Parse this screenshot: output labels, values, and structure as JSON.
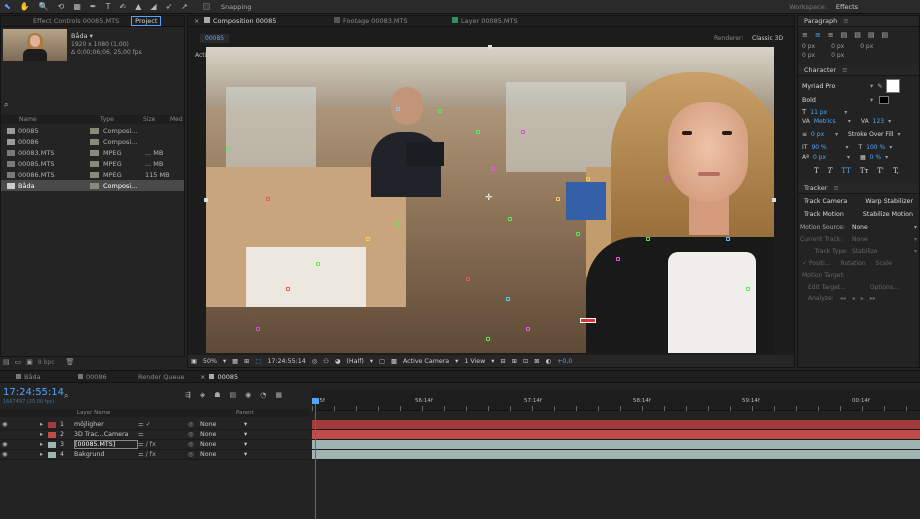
{
  "toolbar": {
    "tools": [
      "⬉",
      "✋",
      "🔍",
      "⟲",
      "▦",
      "✒",
      "T",
      "✍",
      "▲",
      "◢",
      "➶",
      "➚"
    ],
    "snapping": "Snapping",
    "workspace_label": "Workspace:",
    "workspace_value": "Effects"
  },
  "left_panel": {
    "tabs": [
      "Effect Controls 00085.MTS",
      "Project"
    ],
    "item_name": "Båda ▾",
    "item_info1": "1920 x 1080 (1,00)",
    "item_info2": "Δ 0;00;06;06, 25,00 fps",
    "cols": [
      "Name",
      "Type",
      "Size",
      "Med"
    ],
    "items": [
      {
        "name": "00085",
        "type": "Composi...",
        "size": ""
      },
      {
        "name": "00086",
        "type": "Composi...",
        "size": ""
      },
      {
        "name": "00083.MTS",
        "type": "MPEG",
        "size": "... MB"
      },
      {
        "name": "00085.MTS",
        "type": "MPEG",
        "size": "... MB"
      },
      {
        "name": "00086.MTS",
        "type": "MPEG",
        "size": "115 MB"
      },
      {
        "name": "Båda",
        "type": "Composi...",
        "size": ""
      }
    ],
    "bpc": "8 bpc"
  },
  "viewer": {
    "tabs": [
      "Composition 00085",
      "Footage 00083.MTS",
      "Layer 00085.MTS"
    ],
    "comp_btn": "00085",
    "renderer_label": "Renderer:",
    "renderer_value": "Classic 3D",
    "active_camera": "Active Camera",
    "footer": {
      "zoom": "50%",
      "timecode": "17:24:55:14",
      "quality": "(Half)",
      "camera": "Active Camera",
      "view": "1 View",
      "exposure": "+0,0"
    }
  },
  "right": {
    "paragraph": "Paragraph",
    "para_vals": [
      "0 px",
      "0 px",
      "0 px",
      "0 px",
      "0 px"
    ],
    "character": "Character",
    "font": "Myriad Pro",
    "style": "Bold",
    "size": "11 px",
    "tracking_label": "Metrics",
    "kerning": "123",
    "stroke_px": "0 px",
    "stroke_mode": "Stroke Over Fill",
    "vscale": "90 %",
    "hscale": "100 %",
    "baseline": "0 px",
    "tsume": "0 %",
    "styles": [
      "T",
      "T",
      "TT",
      "Tᴛ",
      "T'",
      "T,"
    ],
    "tracker": "Tracker",
    "track_camera": "Track Camera",
    "warp": "Warp Stabilizer",
    "track_motion": "Track Motion",
    "stab_motion": "Stabilize Motion",
    "motion_source_label": "Motion Source:",
    "motion_source": "None",
    "current_track_label": "Current Track:",
    "current_track": "None",
    "track_type_label": "Track Type:",
    "track_type": "Stabilize",
    "position": "Positi...",
    "rotation": "Rotation",
    "scale": "Scale",
    "motion_target": "Motion Target:",
    "edit_target": "Edit Target...",
    "options": "Options...",
    "analyze": "Analyze:"
  },
  "timeline": {
    "tabs": [
      "Båda",
      "00086",
      "Render Queue",
      "00085"
    ],
    "timecode": "17:24:55:14",
    "fps_info": "1667497 (25.00 fps)",
    "layer_header": "Layer Name",
    "parent_header": "Parent",
    "ruler": [
      "55f",
      "56:14f",
      "57:14f",
      "58:14f",
      "59:14f",
      "00:14f"
    ],
    "layers": [
      {
        "num": "1",
        "name": "möjligher",
        "parent": "None",
        "color": "#a23b3b"
      },
      {
        "num": "2",
        "name": "3D Trac...Camera",
        "parent": "None",
        "color": "#c04b4b"
      },
      {
        "num": "3",
        "name": "[00085.MTS]",
        "parent": "None",
        "color": "#9fb3b0"
      },
      {
        "num": "4",
        "name": "Bakgrund",
        "parent": "None",
        "color": "#a0b4b2"
      }
    ]
  }
}
